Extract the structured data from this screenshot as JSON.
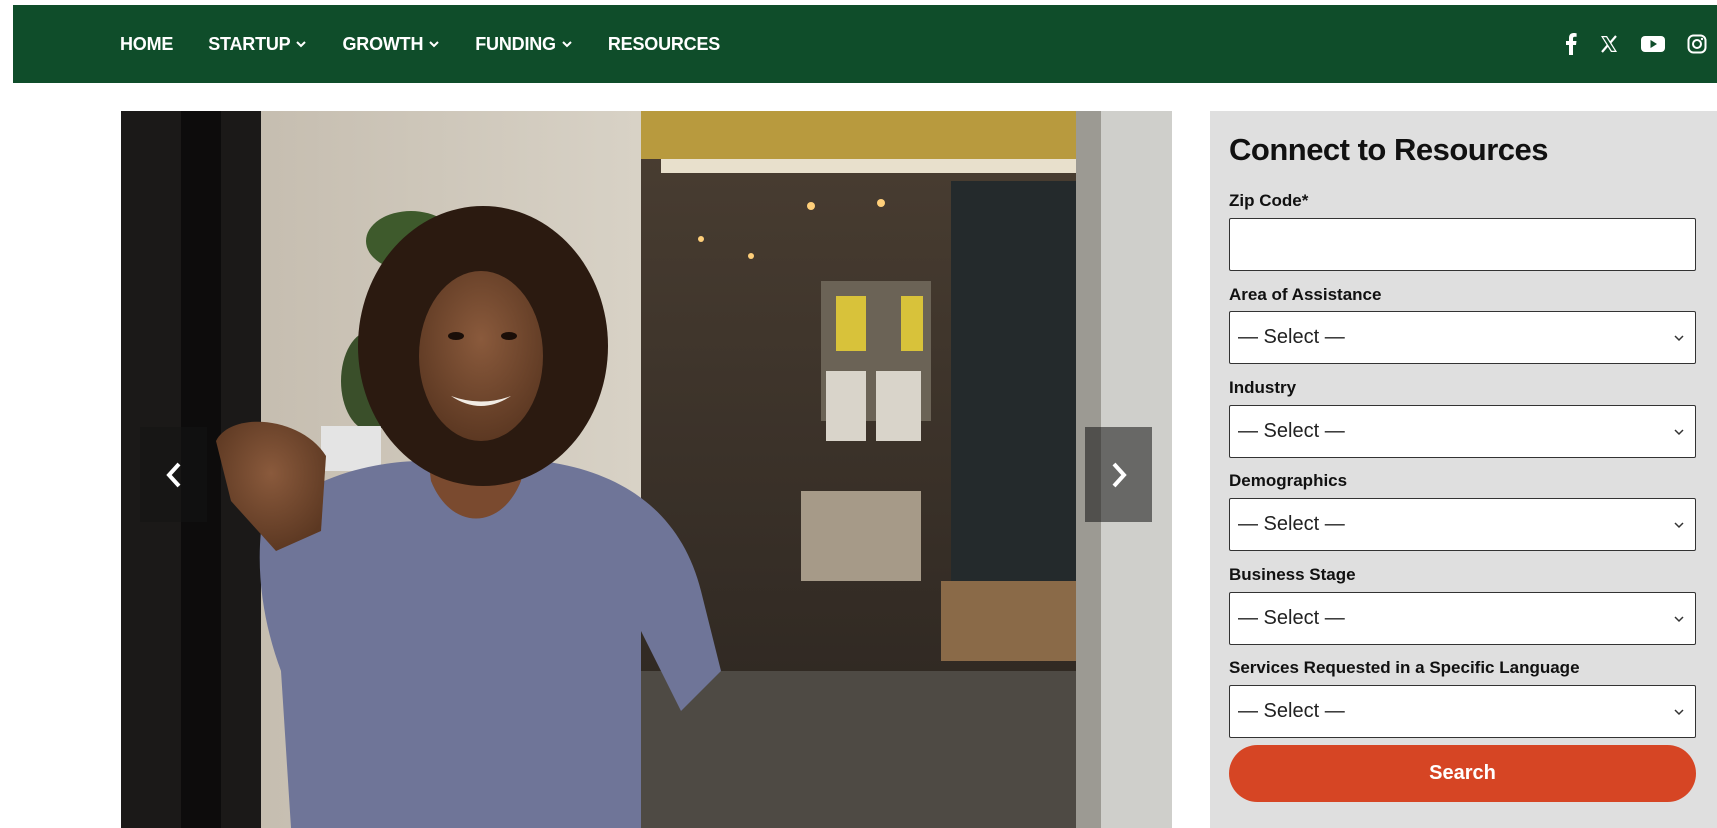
{
  "nav": {
    "items": [
      {
        "label": "HOME",
        "dropdown": false
      },
      {
        "label": "STARTUP",
        "dropdown": true
      },
      {
        "label": "GROWTH",
        "dropdown": true
      },
      {
        "label": "FUNDING",
        "dropdown": true
      },
      {
        "label": "RESOURCES",
        "dropdown": false
      }
    ],
    "social_icons": [
      "facebook-icon",
      "x-icon",
      "youtube-icon",
      "instagram-icon"
    ],
    "background_color": "#0f4d2a"
  },
  "hero": {
    "image_name": "hero-image",
    "prev_icon": "chevron-left-icon",
    "next_icon": "chevron-right-icon"
  },
  "form": {
    "title": "Connect to Resources",
    "zip": {
      "label": "Zip Code*",
      "value": ""
    },
    "fields": [
      {
        "label": "Area of Assistance",
        "selected": "— Select —"
      },
      {
        "label": "Industry",
        "selected": "— Select —"
      },
      {
        "label": "Demographics",
        "selected": "— Select —"
      },
      {
        "label": "Business Stage",
        "selected": "— Select —"
      },
      {
        "label": "Services Requested in a Specific Language",
        "selected": "— Select —"
      }
    ],
    "search_label": "Search",
    "button_color": "#d64524",
    "panel_color": "#dfdfdf"
  }
}
